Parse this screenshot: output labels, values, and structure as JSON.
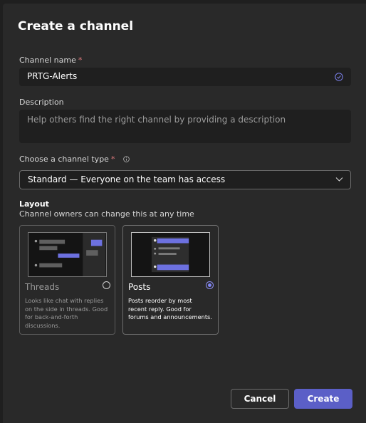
{
  "dialog": {
    "title": "Create a channel",
    "name_label": "Channel name",
    "required_mark": "*",
    "name_value": "PRTG-Alerts",
    "description_label": "Description",
    "description_placeholder": "Help others find the right channel by providing a description",
    "type_label": "Choose a channel type",
    "type_value": "Standard — Everyone on the team has access",
    "layout_title": "Layout",
    "layout_subtitle": "Channel owners can change this at any time",
    "layouts": [
      {
        "title": "Threads",
        "description": "Looks like chat with replies on the side in threads. Good for back-and-forth discussions.",
        "selected": false
      },
      {
        "title": "Posts",
        "description": "Posts reorder by most recent reply. Good for forums and announcements.",
        "selected": true
      }
    ],
    "cancel_label": "Cancel",
    "create_label": "Create"
  },
  "colors": {
    "accent": "#5b5fc7",
    "background": "#292929",
    "required": "#e37d80"
  },
  "icons": [
    "check-circle-icon",
    "info-icon",
    "chevron-down-icon"
  ]
}
